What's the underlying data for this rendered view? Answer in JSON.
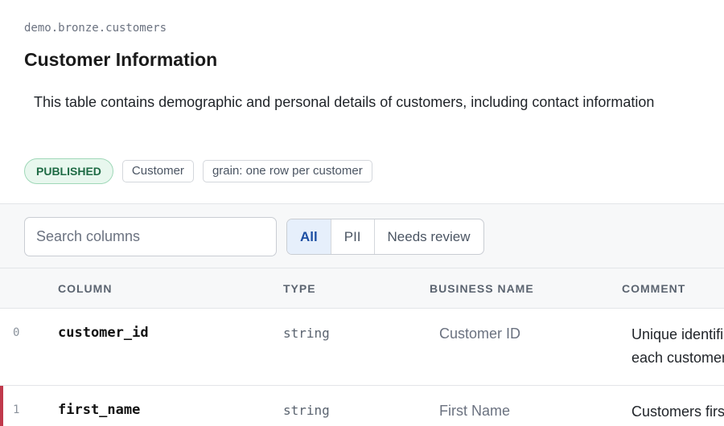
{
  "header": {
    "table_path": "demo.bronze.customers",
    "title": "Customer Information",
    "description": "This table contains demographic and personal details of customers, including contact information"
  },
  "badges": {
    "status": "PUBLISHED",
    "domain": "Customer",
    "grain": "grain: one row per customer"
  },
  "toolbar": {
    "search_placeholder": "Search columns",
    "filters": [
      "All",
      "PII",
      "Needs review"
    ],
    "active_filter": "All"
  },
  "columns_header": [
    "COLUMN",
    "TYPE",
    "BUSINESS NAME",
    "COMMENT"
  ],
  "rows": [
    {
      "index": "0",
      "column": "customer_id",
      "type": "string",
      "business_name": "Customer ID",
      "comment": "Unique identifier for each customer."
    },
    {
      "index": "1",
      "column": "first_name",
      "type": "string",
      "business_name": "First Name",
      "comment": "Customers first name"
    }
  ],
  "colors": {
    "accent": "#1d4fa3",
    "published_bg": "#e8f7ee",
    "published_text": "#1f6b45",
    "selected_marker": "#c0394b"
  }
}
